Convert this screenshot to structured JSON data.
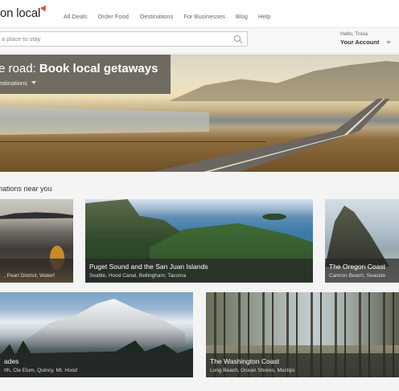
{
  "brand": {
    "logo_text": "on local"
  },
  "nav": {
    "items": [
      "All Deals",
      "Order Food",
      "Destinations",
      "For Businesses",
      "Blog",
      "Help"
    ]
  },
  "search": {
    "placeholder": "a place to stay"
  },
  "account": {
    "greeting": "Hello, Tricia",
    "label": "Your Account"
  },
  "hero": {
    "title_prefix": "e road: ",
    "title_bold": "Book local getaways",
    "subtitle": "estinations"
  },
  "section": {
    "title": "nations near you"
  },
  "cards": [
    {
      "title": "",
      "subtitle": ", Pearl District, Waterf"
    },
    {
      "title": "Puget Sound and the San Juan Islands",
      "subtitle": "Seattle, Hood Canal, Bellingham, Tacoma"
    },
    {
      "title": "The Oregon Coast",
      "subtitle": "Cannon Beach, Seaside"
    },
    {
      "title": "ades",
      "subtitle": "rth, Cle Elum, Quincy, Mt. Hood"
    },
    {
      "title": "The Washington Coast",
      "subtitle": "Long Beach, Ocean Shores, Moclips"
    }
  ],
  "colors": {
    "accent": "#e2522f",
    "hero_panel": "#55524b",
    "caption_bg": "#282828"
  },
  "icons": [
    "logo-mark-icon",
    "search-icon",
    "chevron-down-icon"
  ]
}
